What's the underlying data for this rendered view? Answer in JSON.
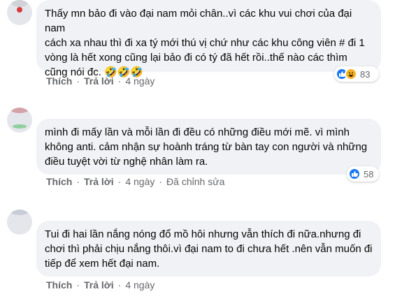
{
  "colors": {
    "bubble": "#f0f2f5",
    "text": "#050505",
    "secondary": "#65676b",
    "like_blue": "#1877f2",
    "haha_yellow": "#f7b125"
  },
  "comments": [
    {
      "lines": [
        "Thấy mn bảo đi vào đại nam mỏi chân..vì các khu vui chơi của đại nam",
        "cách xa nhau thì đi xa tý mới thú vị chứ như các khu công viên # đi 1",
        "vòng là hết xong cũng lại bảo đi có tý đã hết rồi..thế nào các thìm",
        "cũng nói đc. 🤣🤣🤣"
      ],
      "like_label": "Thích",
      "reply_label": "Trả lời",
      "time": "4 ngày",
      "edited": "",
      "reaction_icons": [
        "like-icon",
        "haha-icon"
      ],
      "reaction_count": "83"
    },
    {
      "lines": [
        "mình đi mấy lần và mỗi lần đi đều có những điều mới mẽ. vì mình",
        "không anti. cảm nhận sự hoành tráng từ bàn tay con người và những",
        "điều tuyệt vời từ nghệ nhân làm ra."
      ],
      "like_label": "Thích",
      "reply_label": "Trả lời",
      "time": "4 ngày",
      "edited": "Đã chỉnh sửa",
      "reaction_icons": [
        "like-icon"
      ],
      "reaction_count": "58"
    },
    {
      "lines": [
        "Tui đi hai lần nắng nóng đổ mồ hôi nhưng vẫn thích đi nữa.nhưng đi",
        "chơi thì phải chịu nắng thôi.vì đại nam to đi chưa hết .nên vẫn muốn đi",
        "tiếp để xem hết đại nam."
      ],
      "like_label": "Thích",
      "reply_label": "Trả lời",
      "time": "4 ngày",
      "edited": "",
      "reaction_icons": [],
      "reaction_count": ""
    }
  ]
}
